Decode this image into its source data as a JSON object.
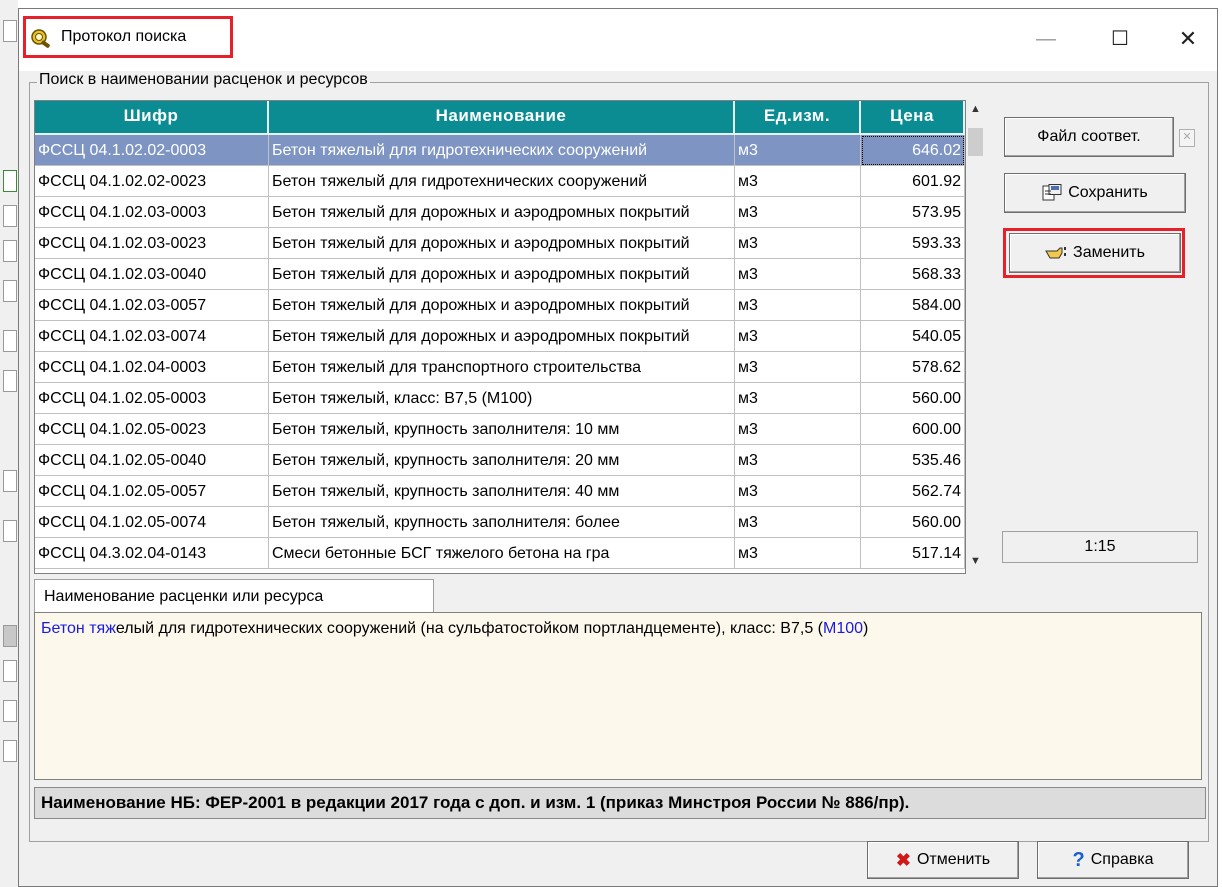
{
  "window": {
    "title": "Протокол поиска"
  },
  "group": {
    "caption": "Поиск в наименовании расценок и ресурсов"
  },
  "table": {
    "columns": [
      "Шифр",
      "Наименование",
      "Ед.изм.",
      "Цена"
    ],
    "rows": [
      {
        "code": "ФССЦ 04.1.02.02-0003",
        "name": "Бетон тяжелый для гидротехнических сооружений",
        "unit": "м3",
        "price": "646.02"
      },
      {
        "code": "ФССЦ 04.1.02.02-0023",
        "name": "Бетон тяжелый для гидротехнических сооружений",
        "unit": "м3",
        "price": "601.92"
      },
      {
        "code": "ФССЦ 04.1.02.03-0003",
        "name": "Бетон тяжелый для дорожных и аэродромных покрытий",
        "unit": "м3",
        "price": "573.95"
      },
      {
        "code": "ФССЦ 04.1.02.03-0023",
        "name": "Бетон тяжелый для дорожных и аэродромных покрытий",
        "unit": "м3",
        "price": "593.33"
      },
      {
        "code": "ФССЦ 04.1.02.03-0040",
        "name": "Бетон тяжелый для дорожных и аэродромных покрытий",
        "unit": "м3",
        "price": "568.33"
      },
      {
        "code": "ФССЦ 04.1.02.03-0057",
        "name": "Бетон тяжелый для дорожных и аэродромных покрытий",
        "unit": "м3",
        "price": "584.00"
      },
      {
        "code": "ФССЦ 04.1.02.03-0074",
        "name": "Бетон тяжелый для дорожных и аэродромных покрытий",
        "unit": "м3",
        "price": "540.05"
      },
      {
        "code": "ФССЦ 04.1.02.04-0003",
        "name": "Бетон тяжелый для транспортного строительства",
        "unit": "м3",
        "price": "578.62"
      },
      {
        "code": "ФССЦ 04.1.02.05-0003",
        "name": "Бетон тяжелый, класс: В7,5 (М100)",
        "unit": "м3",
        "price": "560.00"
      },
      {
        "code": "ФССЦ 04.1.02.05-0023",
        "name": "Бетон тяжелый, крупность заполнителя: 10 мм",
        "unit": "м3",
        "price": "600.00"
      },
      {
        "code": "ФССЦ 04.1.02.05-0040",
        "name": "Бетон тяжелый, крупность заполнителя: 20 мм",
        "unit": "м3",
        "price": "535.46"
      },
      {
        "code": "ФССЦ 04.1.02.05-0057",
        "name": "Бетон тяжелый, крупность заполнителя: 40 мм",
        "unit": "м3",
        "price": "562.74"
      },
      {
        "code": "ФССЦ 04.1.02.05-0074",
        "name": "Бетон тяжелый, крупность заполнителя: более",
        "unit": "м3",
        "price": "560.00"
      },
      {
        "code": "ФССЦ 04.3.02.04-0143",
        "name": "Смеси бетонные БСГ тяжелого бетона на гра",
        "unit": "м3",
        "price": "517.14"
      }
    ],
    "selected_index": 0
  },
  "buttons": {
    "file_match": "Файл соответ.",
    "save": "Сохранить",
    "replace": "Заменить",
    "cancel": "Отменить",
    "help": "Справка"
  },
  "counter": "1:15",
  "tab": {
    "label": "Наименование расценки или ресурса"
  },
  "description": {
    "part1": "Бетон тяж",
    "part2": "елый для гидротехнических сооружений (на сульфатостойком портландцементе), класс: В7,5 (",
    "part3": "М100",
    "part4": ")"
  },
  "nb_line": "Наименование НБ: ФЕР-2001 в редакции 2017 года с доп. и изм. 1 (приказ Минстроя России № 886/пр).",
  "colors": {
    "header_bg": "#0a8c92",
    "selected_row": "#7e95c4",
    "highlight_red": "#e8202a",
    "desc_bg": "#fcf9ec",
    "highlight_text": "#1a1ae0"
  },
  "icons": {
    "app": "search-protocol-icon",
    "close_small": "close-icon",
    "save": "save-icon",
    "replace": "hand-pointer-icon",
    "cancel": "red-x-icon",
    "help": "question-icon"
  }
}
